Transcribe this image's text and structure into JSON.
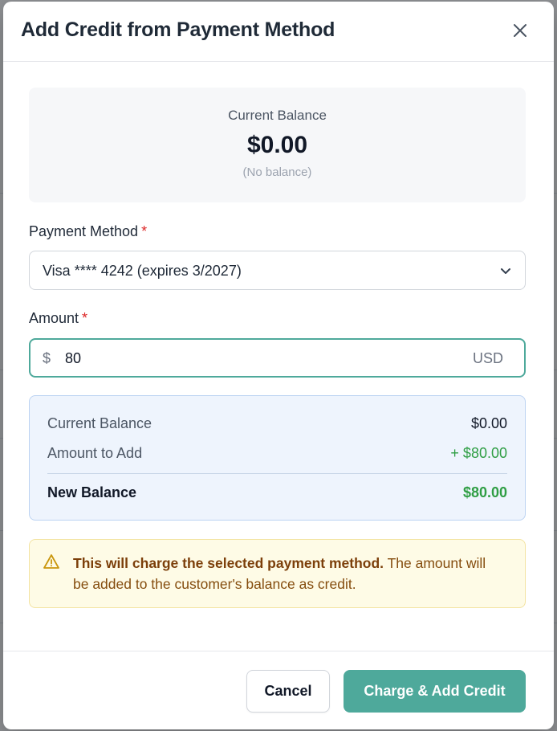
{
  "dialog": {
    "title": "Add Credit from Payment Method",
    "close_icon": "close-icon"
  },
  "balance_card": {
    "label": "Current Balance",
    "amount": "$0.00",
    "note": "(No balance)"
  },
  "payment_method": {
    "label": "Payment Method",
    "required_mark": "*",
    "selected": "Visa **** 4242 (expires 3/2027)"
  },
  "amount": {
    "label": "Amount",
    "required_mark": "*",
    "currency_symbol": "$",
    "value": "80",
    "unit": "USD"
  },
  "summary": {
    "current_label": "Current Balance",
    "current_value": "$0.00",
    "add_label": "Amount to Add",
    "add_value": "+ $80.00",
    "new_label": "New Balance",
    "new_value": "$80.00"
  },
  "warning": {
    "bold": "This will charge the selected payment method.",
    "rest": " The amount will be added to the customer's balance as credit."
  },
  "footer": {
    "cancel_label": "Cancel",
    "submit_label": "Charge & Add Credit"
  },
  "colors": {
    "accent": "#4ea99b",
    "positive": "#2f9e44",
    "required": "#dc2626",
    "warning_text": "#854d0e"
  }
}
